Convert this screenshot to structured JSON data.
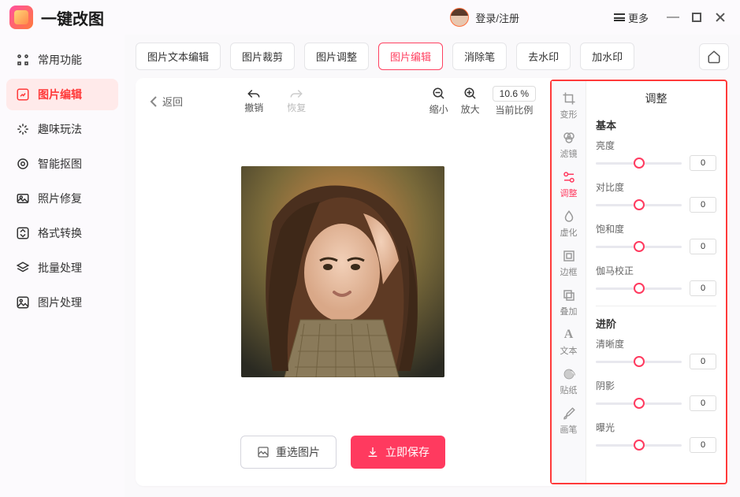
{
  "app": {
    "title": "一键改图",
    "login": "登录/注册",
    "more": "更多"
  },
  "sidebar": {
    "items": [
      {
        "label": "常用功能"
      },
      {
        "label": "图片编辑"
      },
      {
        "label": "趣味玩法"
      },
      {
        "label": "智能抠图"
      },
      {
        "label": "照片修复"
      },
      {
        "label": "格式转换"
      },
      {
        "label": "批量处理"
      },
      {
        "label": "图片处理"
      }
    ]
  },
  "tabs": [
    {
      "label": "图片文本编辑"
    },
    {
      "label": "图片裁剪"
    },
    {
      "label": "图片调整"
    },
    {
      "label": "图片编辑"
    },
    {
      "label": "消除笔"
    },
    {
      "label": "去水印"
    },
    {
      "label": "加水印"
    }
  ],
  "toolbar": {
    "back": "返回",
    "undo": "撤销",
    "redo": "恢复",
    "zoom_out": "缩小",
    "zoom_in": "放大",
    "zoom_value": "10.6 %",
    "zoom_label": "当前比例"
  },
  "actions": {
    "reselect": "重选图片",
    "save": "立即保存"
  },
  "rail": {
    "items": [
      {
        "label": "变形"
      },
      {
        "label": "滤镜"
      },
      {
        "label": "调整"
      },
      {
        "label": "虚化"
      },
      {
        "label": "边框"
      },
      {
        "label": "叠加"
      },
      {
        "label": "文本"
      },
      {
        "label": "贴纸"
      },
      {
        "label": "画笔"
      }
    ]
  },
  "adjust": {
    "title": "调整",
    "basic": {
      "title": "基本",
      "sliders": [
        {
          "label": "亮度",
          "value": "0"
        },
        {
          "label": "对比度",
          "value": "0"
        },
        {
          "label": "饱和度",
          "value": "0"
        },
        {
          "label": "伽马校正",
          "value": "0"
        }
      ]
    },
    "advanced": {
      "title": "进阶",
      "sliders": [
        {
          "label": "清晰度",
          "value": "0"
        },
        {
          "label": "阴影",
          "value": "0"
        },
        {
          "label": "曝光",
          "value": "0"
        }
      ]
    }
  }
}
